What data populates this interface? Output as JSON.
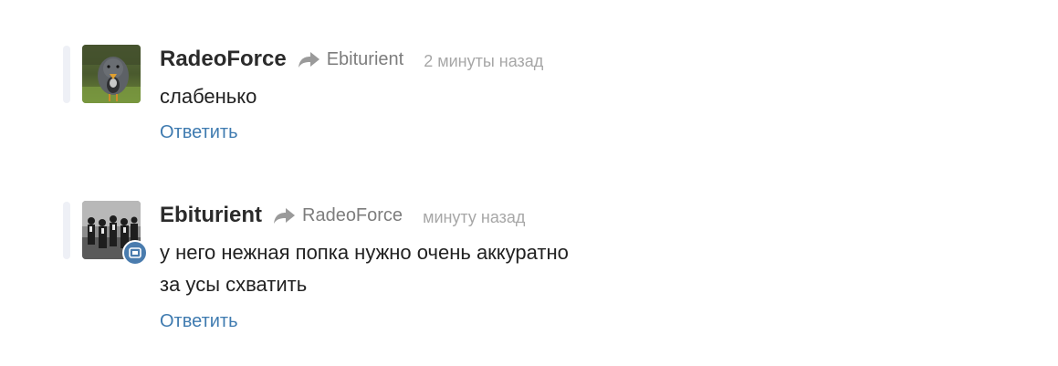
{
  "comments": [
    {
      "author": "RadeoForce",
      "reply_to": "Ebiturient",
      "time": "2 минуты назад",
      "text_lines": [
        "слабенько"
      ],
      "reply_label": "Ответить",
      "avatar_icon": "goose-photo-icon",
      "has_badge": false
    },
    {
      "author": "Ebiturient",
      "reply_to": "RadeoForce",
      "time": "минуту назад",
      "text_lines": [
        "у него нежная попка нужно очень аккуратно",
        "за усы схватить"
      ],
      "reply_label": "Ответить",
      "avatar_icon": "group-photo-icon",
      "has_badge": true,
      "badge_icon": "camera-badge-icon"
    }
  ],
  "colors": {
    "author": "#2b2b2b",
    "reply_to": "#7d7d7d",
    "time": "#a7a7a7",
    "link": "#3f7bb0",
    "indent_bar": "#eef0f6",
    "badge": "#4a7cae"
  }
}
